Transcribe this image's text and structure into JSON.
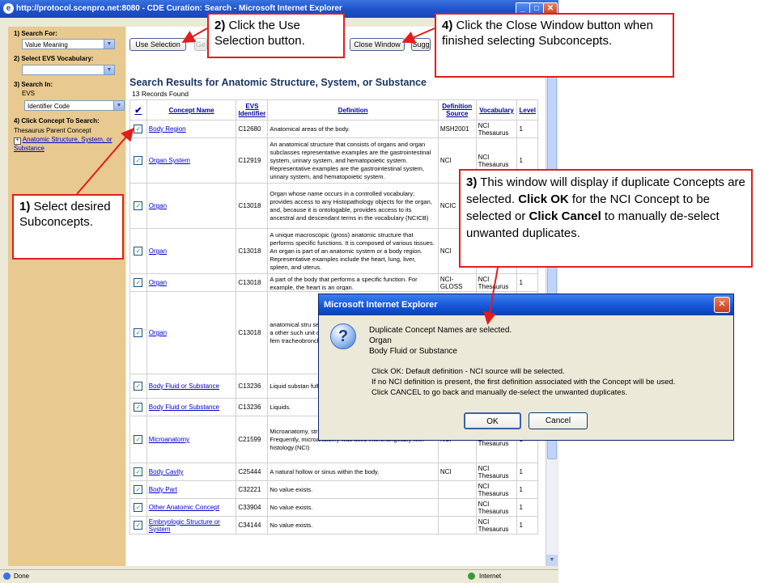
{
  "window": {
    "title": "http://protocol.scenpro.net:8080 - CDE Curation: Search - Microsoft Internet Explorer",
    "min_icon": "minimize-icon",
    "max_icon": "maximize-icon",
    "close_icon": "close-icon"
  },
  "sidebar": {
    "search_for_label": "1) Search For:",
    "search_for_value": "Value Meaning",
    "vocab_label": "2) Select EVS Vocabulary:",
    "vocab_value": "",
    "search_in_label": "3) Search In:",
    "search_in_sub": "EVS",
    "search_in_value": "Identifier Code",
    "click_concept_label": "4) Click Concept To Search:",
    "parent_concept_label": "Thesaurus Parent Concept",
    "parent_concept_link": "Anatomic Structure, System, or Substance"
  },
  "toolbar": {
    "use_selection": "Use Selection",
    "get_partial": "Ge",
    "close_window": "Close Window",
    "suggest_partial": "Sugg"
  },
  "results": {
    "heading": "Search Results for Anatomic Structure, System, or Substance",
    "count": "13 Records Found",
    "columns": [
      "Concept Name",
      "EVS Identifier",
      "Definition",
      "Definition Source",
      "Vocabulary",
      "Level"
    ],
    "rows": [
      {
        "name": "Body Region",
        "id": "C12680",
        "def": "Anatomical areas of the body.",
        "src": "MSH2001",
        "vocab": "NCI Thesaurus",
        "level": "1"
      },
      {
        "name": "Organ System",
        "id": "C12919",
        "def": "An anatomical structure that consists of organs and organ subclasses representative examples are the gastrointestinal system, urinary system, and hematopoietic system. Representative examples are the gastrointestinal system, urinary system, and hematopoietic system.",
        "src": "NCI",
        "vocab": "NCI Thesaurus",
        "level": "1"
      },
      {
        "name": "Organ",
        "id": "C13018",
        "def": "Organ whose name occurs in a controlled vocabulary; provides access to any Histopathology objects for the organ, and, because it is ontologable, provides access to its ancestral and descendant terms in the vocabulary (NCICB)",
        "src": "NCIC",
        "vocab": "",
        "level": ""
      },
      {
        "name": "Organ",
        "id": "C13018",
        "def": "A unique macroscopic (gross) anatomic structure that performs specific functions. It is composed of various tissues. An organ is part of an anatomic system or a body region. Representative examples include the heart, lung, liver, spleen, and uterus.",
        "src": "NCI",
        "vocab": "",
        "level": ""
      },
      {
        "name": "Organ",
        "id": "C13018",
        "def": "A part of the body that performs a specific function. For example, the heart is an organ.",
        "src": "NCI-GLOSS",
        "vocab": "NCI Thesaurus",
        "level": "1"
      },
      {
        "name": "Organ",
        "id": "C13018",
        "def": "anatomical stru set of organ pa together they co macroscopic a other such unit organ constitut organ is divisib Examples: fem tracheobronchi",
        "src": "",
        "vocab": "",
        "level": ""
      },
      {
        "name": "Body Fluid or Substance",
        "id": "C13236",
        "def": "Liquid substan fulfill specific fu Secretions do n",
        "src": "",
        "vocab": "",
        "level": ""
      },
      {
        "name": "Body Fluid or Substance",
        "id": "C13236",
        "def": "Liquids.",
        "src": "",
        "vocab": "",
        "level": ""
      },
      {
        "name": "Microanatomy",
        "id": "C21599",
        "def": "Microanatomy, structure of cell tissues at microscopic level. Frequently, microanatomy was used interchangeably with histology.(NCI)",
        "src": "NCI",
        "vocab": "NCI Thesaurus",
        "level": "1"
      },
      {
        "name": "Body Cavity",
        "id": "C25444",
        "def": "A natural hollow or sinus within the body.",
        "src": "NCI",
        "vocab": "NCI Thesaurus",
        "level": "1"
      },
      {
        "name": "Body Part",
        "id": "C32221",
        "def": "No value exists.",
        "src": "",
        "vocab": "NCI Thesaurus",
        "level": "1"
      },
      {
        "name": "Other Anatomic Concept",
        "id": "C33904",
        "def": "No value exists.",
        "src": "",
        "vocab": "NCI Thesaurus",
        "level": "1"
      },
      {
        "name": "Embryologic Structure or System",
        "id": "C34144",
        "def": "No value exists.",
        "src": "",
        "vocab": "NCI Thesaurus",
        "level": "1"
      }
    ]
  },
  "status": {
    "left": "Done",
    "zone": "Internet"
  },
  "callouts": {
    "c1_num": "1)",
    "c1_text": " Select desired Subconcepts.",
    "c2_num": "2)",
    "c2_text": " Click the Use Selection button.",
    "c4_num": "4)",
    "c4_text": " Click the Close Window button when finished selecting Subconcepts.",
    "c3_num": "3)",
    "c3_a": " This window will display if duplicate Concepts are selected. ",
    "c3_b": "Click OK",
    "c3_c": " for the NCI Concept to be selected or ",
    "c3_d": "Click Cancel",
    "c3_e": " to manually de-select unwanted duplicates."
  },
  "dialog": {
    "title": "Microsoft Internet Explorer",
    "line1": "Duplicate Concept Names are selected.",
    "line2": "Organ",
    "line3": "Body Fluid or Substance",
    "line4": "Click OK: Default definition - NCI source will be selected.",
    "line5": "If no NCI definition is present, the first definition associated with the Concept will be used.",
    "line6": "Click CANCEL to go back and manually de-select the unwanted duplicates.",
    "ok": "OK",
    "cancel": "Cancel"
  },
  "colors": {
    "callout_border": "#e11d1d",
    "sidebar_bg": "#e8c990",
    "link": "#0000cc"
  }
}
